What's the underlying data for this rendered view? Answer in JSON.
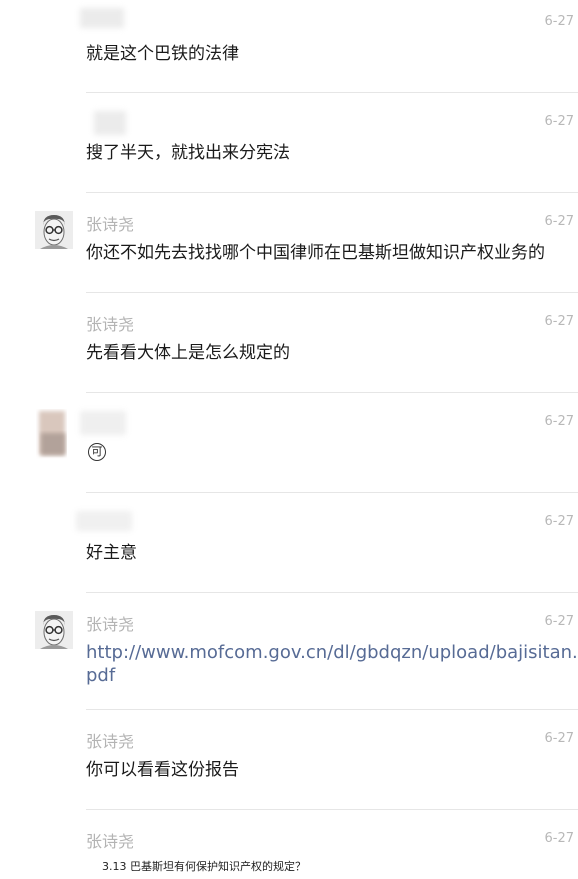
{
  "messages": [
    {
      "sender": "",
      "time": "6-27",
      "text": "就是这个巴铁的法律"
    },
    {
      "sender": "",
      "time": "6-27",
      "text": "搜了半天，就找出来分宪法"
    },
    {
      "sender": "张诗尧",
      "time": "6-27",
      "text": "你还不如先去找找哪个中国律师在巴基斯坦做知识产权业务的"
    },
    {
      "sender": "张诗尧",
      "time": "6-27",
      "text": "先看看大体上是怎么规定的"
    },
    {
      "sender": "",
      "time": "6-27",
      "emoji": "可"
    },
    {
      "sender": "",
      "time": "6-27",
      "text": "好主意"
    },
    {
      "sender": "张诗尧",
      "time": "6-27",
      "link_line1": "http://www.mofcom.gov.cn/dl/gbdqzn/upload/bajisitan.",
      "link_line2": "pdf"
    },
    {
      "sender": "张诗尧",
      "time": "6-27",
      "text": "你可以看看这份报告"
    },
    {
      "sender": "张诗尧",
      "time": "6-27",
      "image_caption": "3.13 巴基斯坦有何保护知识产权的规定？"
    }
  ],
  "colors": {
    "name": "#b3b3b3",
    "time": "#b8b8b8",
    "text": "#1a1a1a",
    "link": "#576b95",
    "separator": "#e6e6e6"
  }
}
